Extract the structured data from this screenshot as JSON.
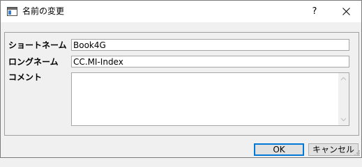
{
  "window": {
    "title": "名前の変更",
    "help_label": "?",
    "icons": {
      "app": "dialog-app-icon",
      "close": "close-icon"
    }
  },
  "fields": {
    "short_name": {
      "label": "ショートネーム",
      "value": "Book4G"
    },
    "long_name": {
      "label": "ロングネーム",
      "value": "CC.MI-Index"
    },
    "comment": {
      "label": "コメント",
      "value": ""
    }
  },
  "buttons": {
    "ok": "OK",
    "cancel": "キャンセル"
  },
  "colors": {
    "dialog_background": "#f0f0f0",
    "title_bar": "#ffffff",
    "default_button_border": "#0078d7"
  }
}
